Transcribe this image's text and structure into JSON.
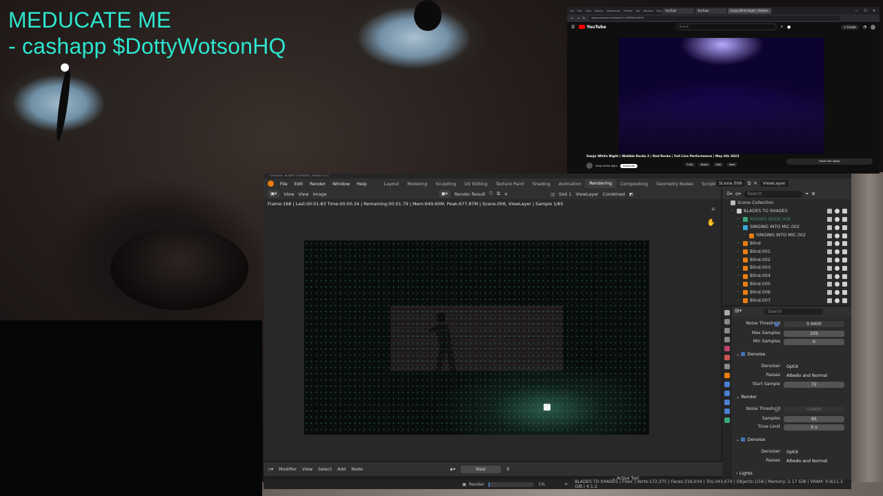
{
  "overlay": {
    "line1": "MEDUCATE ME",
    "line2": "- cashapp $DottyWotsonHQ"
  },
  "youtube": {
    "menu": [
      "File",
      "Edit",
      "View",
      "History",
      "Bookmarks",
      "Profiles",
      "Tab",
      "Window",
      "Help"
    ],
    "tabs": [
      "YouTube",
      "YouTube",
      "Ganja White Night | Wobble"
    ],
    "url": "www.youtube.com/watch?v=RD9WvSbXhG",
    "logo": "YouTube",
    "search_placeholder": "Search",
    "create_label": "+ Create",
    "video_title": "Ganja White Night | Wobble Rocks 2 | Red Rocks | Full Live Performance | May 6th 2023",
    "channel": "Ganja White Night",
    "subscribe": "Subscribe",
    "actions": [
      "5.4K",
      "Share",
      "Add",
      "Save"
    ],
    "chat_btn": "Show chat replay"
  },
  "blender": {
    "titlebar": "* [Unsaved - BLADES TO SHADES] - Blender 4.1.1",
    "menu": [
      "File",
      "Edit",
      "Render",
      "Window",
      "Help"
    ],
    "workspaces": [
      "Layout",
      "Modeling",
      "Sculpting",
      "UV Editing",
      "Texture Paint",
      "Shading",
      "Animation",
      "Rendering",
      "Compositing",
      "Geometry Nodes",
      "Scripting"
    ],
    "active_workspace": "Rendering",
    "scene": "Scene.006",
    "view_layer": "ViewLayer",
    "image_editor": {
      "view": "View",
      "view2": "View",
      "image": "Image",
      "image_name": "Render Result",
      "slot": "Slot 1",
      "layer": "ViewLayer",
      "pass": "Combined",
      "stats": "Frame:168 | Last:00:01.83 Time:00:00.34 | Remaining:00:01.79 | Mem:649.60M, Peak:677.87M | Scene.006, ViewLayer | Sample 1/65"
    },
    "node_editor": {
      "type": "Modifier",
      "menus": [
        "View",
        "Select",
        "Add",
        "Node"
      ],
      "new": "New"
    },
    "outliner": {
      "search_placeholder": "Search",
      "rows": [
        {
          "label": "Scene Collection",
          "depth": 0,
          "icon": "#bbbbbb"
        },
        {
          "label": "BLADES TO SHADES",
          "depth": 1,
          "icon": "#cccccc"
        },
        {
          "label": "RIGGED DUDE.008",
          "depth": 2,
          "icon": "#3aa77a",
          "dim": true
        },
        {
          "label": "SINGING INTO MIC.002",
          "depth": 2,
          "icon": "#3aa7d7"
        },
        {
          "label": "SINGING INTO MIC.002",
          "depth": 3,
          "icon": "#e87d0d"
        },
        {
          "label": "Blind",
          "depth": 2,
          "icon": "#e87d0d"
        },
        {
          "label": "Blind.001",
          "depth": 2,
          "icon": "#e87d0d"
        },
        {
          "label": "Blind.002",
          "depth": 2,
          "icon": "#e87d0d"
        },
        {
          "label": "Blind.003",
          "depth": 2,
          "icon": "#e87d0d"
        },
        {
          "label": "Blind.004",
          "depth": 2,
          "icon": "#e87d0d"
        },
        {
          "label": "Blind.005",
          "depth": 2,
          "icon": "#e87d0d"
        },
        {
          "label": "Blind.006",
          "depth": 2,
          "icon": "#e87d0d"
        },
        {
          "label": "Blind.007",
          "depth": 2,
          "icon": "#e87d0d"
        }
      ]
    },
    "properties": {
      "search_placeholder": "Search",
      "viewport_noise_label": "Noise Threshold",
      "viewport_noise": "0.9400",
      "max_samples_label": "Max Samples",
      "max_samples": "105",
      "min_samples_label": "Min Samples",
      "min_samples": "0",
      "denoise1": "Denoise",
      "denoiser_label": "Denoiser",
      "denoiser": "OptiX",
      "passes_label": "Passes",
      "passes": "Albedo and Normal",
      "start_sample_label": "Start Sample",
      "start_sample": "72",
      "render_section": "Render",
      "render_noise_label": "Noise Threshold",
      "render_noise": "0.9400",
      "samples_label": "Samples",
      "samples": "65",
      "time_limit_label": "Time Limit",
      "time_limit": "0 s",
      "denoise2": "Denoise",
      "denoiser2_label": "Denoiser",
      "denoiser2": "OptiX",
      "passes2_label": "Passes",
      "passes2": "Albedo and Normal",
      "lights": "Lights"
    },
    "status": {
      "render_label": "Render",
      "progress_text": "1%",
      "progress_fraction": 0.01,
      "active_tool": "Active Tool",
      "scene_stats": "BLADES TO SHADES | Floor | Verts:172,375 | Faces:316,034 | Tris:343,674 | Objects:1/58 | Memory: 2.17 GiB | VRAM: 0.9/11.1 GiB | 4.1.2"
    }
  }
}
